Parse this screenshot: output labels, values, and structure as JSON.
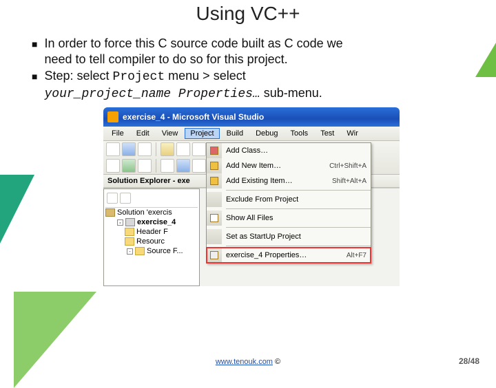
{
  "slide": {
    "title": "Using VC++",
    "bullet1_a": "In order to force this C source code built as C code we",
    "bullet1_b": "need to tell compiler to do so for this project.",
    "bullet2_a": "Step: select ",
    "bullet2_code1": "Project",
    "bullet2_b": " menu > select",
    "bullet2_code2": "your_project_name Properties…",
    "bullet2_c": " sub-menu."
  },
  "vs": {
    "title": "exercise_4 - Microsoft Visual Studio",
    "menu": {
      "file": "File",
      "edit": "Edit",
      "view": "View",
      "project": "Project",
      "build": "Build",
      "debug": "Debug",
      "tools": "Tools",
      "test": "Test",
      "wir": "Wir"
    },
    "solutionExplorerHeader": "Solution Explorer - exe",
    "tree": {
      "sln": "Solution 'exercis",
      "proj": "exercise_4",
      "hdr": "Header F",
      "res": "Resourc",
      "src": "Source F..."
    },
    "dropdown": {
      "add_class": "Add Class…",
      "add_new": "Add New Item…",
      "add_new_sc": "Ctrl+Shift+A",
      "add_existing": "Add Existing Item…",
      "add_existing_sc": "Shift+Alt+A",
      "exclude": "Exclude From Project",
      "show_all": "Show All Files",
      "startup": "Set as StartUp Project",
      "props": "exercise_4 Properties…",
      "props_sc": "Alt+F7"
    }
  },
  "footer": {
    "link": "www.tenouk.com",
    "copy": " ©"
  },
  "page": "28/48"
}
